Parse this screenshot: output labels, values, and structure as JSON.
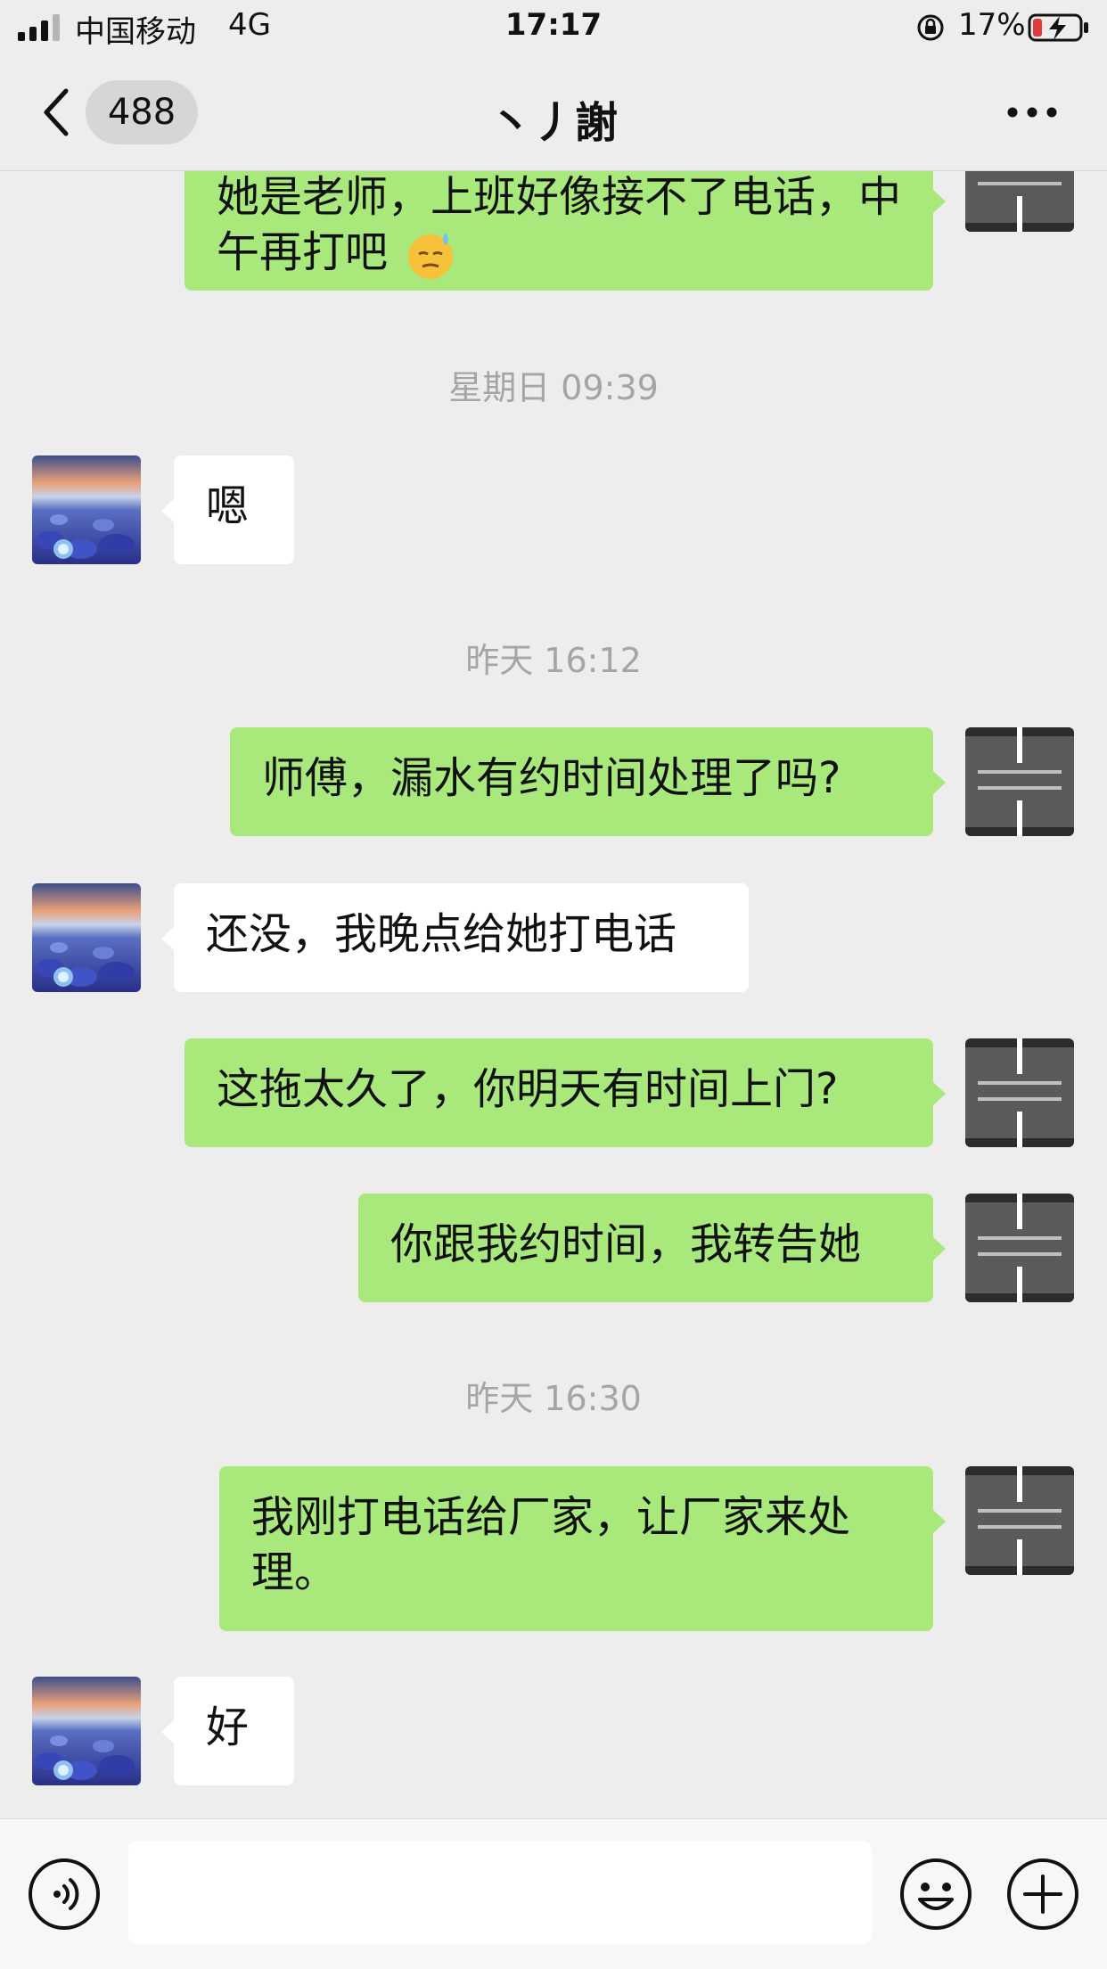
{
  "status_bar": {
    "carrier": "中国移动",
    "network": "4G",
    "time": "17:17",
    "battery": "17%"
  },
  "header": {
    "unread_count": "488",
    "title": "丶丿謝"
  },
  "messages": {
    "m1": "她是老师，上班好像接不了电话，中午再打吧",
    "t1": "星期日 09:39",
    "m2": "嗯",
    "t2": "昨天 16:12",
    "m3": "师傅，漏水有约时间处理了吗?",
    "m4": "还没，我晚点给她打电话",
    "m5": "这拖太久了，你明天有时间上门?",
    "m6": "你跟我约时间，我转告她",
    "t3": "昨天 16:30",
    "m7": "我刚打电话给厂家，让厂家来处理。",
    "m8": "好"
  },
  "input": {
    "placeholder": ""
  },
  "colors": {
    "sent_bubble": "#a9e97b",
    "received_bubble": "#ffffff",
    "background": "#ededed",
    "timestamp": "#a5a5a5"
  },
  "icons": {
    "back": "chevron-left-icon",
    "more": "more-dots-icon",
    "voice": "voice-icon",
    "emoji": "emoji-face-icon",
    "plus": "plus-circle-icon"
  }
}
